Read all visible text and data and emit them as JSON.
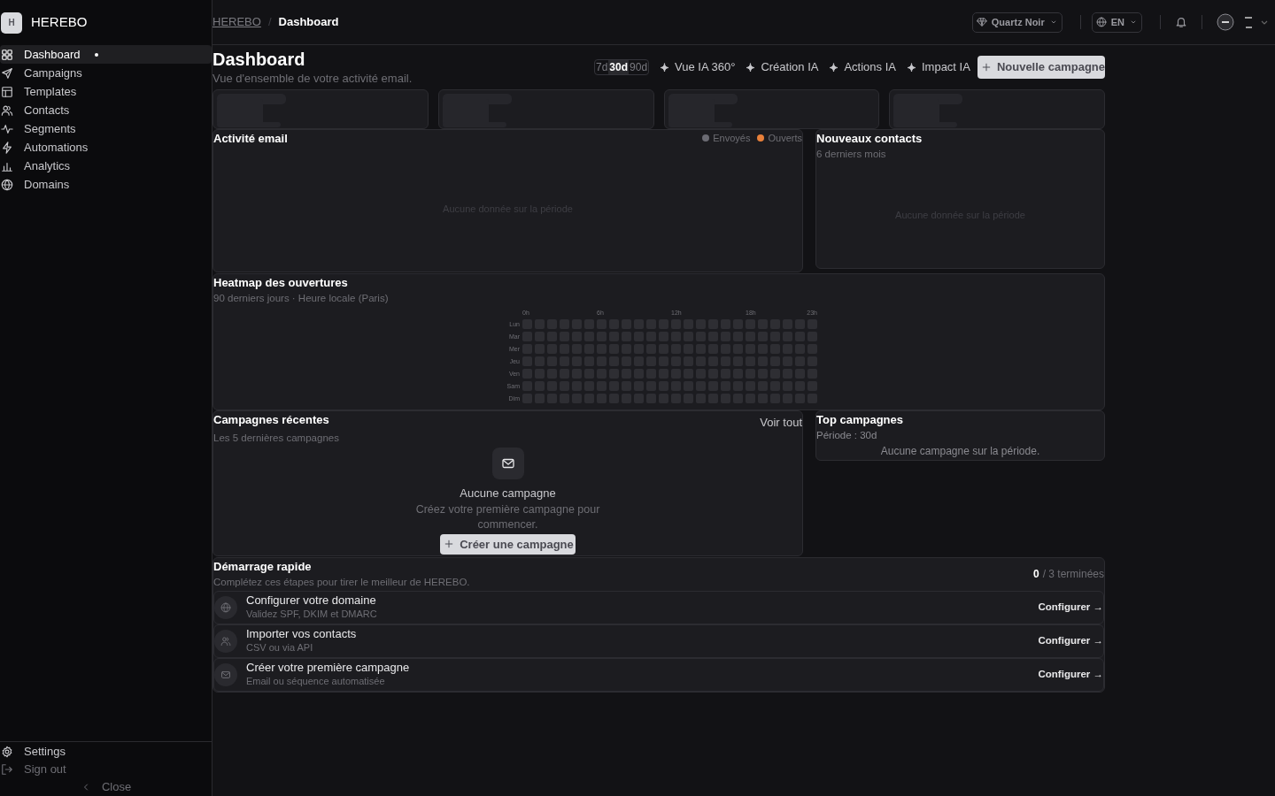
{
  "sidebar": {
    "brand": "HEREBO",
    "logo_letter": "H",
    "items": [
      {
        "label": "Dashboard",
        "selected": true
      },
      {
        "label": "Campaigns",
        "selected": false
      },
      {
        "label": "Templates",
        "selected": false
      },
      {
        "label": "Contacts",
        "selected": false
      },
      {
        "label": "Segments",
        "selected": false
      },
      {
        "label": "Automations",
        "selected": false
      },
      {
        "label": "Analytics",
        "selected": false
      },
      {
        "label": "Domains",
        "selected": false
      }
    ],
    "footer": [
      {
        "label": "Settings",
        "kind": "settings"
      },
      {
        "label": "Sign out",
        "kind": "signout"
      }
    ],
    "close": "Close"
  },
  "header": {
    "breadcrumb": [
      "HEREBO",
      "Dashboard"
    ],
    "breadcrumb_separator": "/",
    "theme": "Quartz Noir",
    "language": "EN"
  },
  "page": {
    "title": "Dashboard",
    "subtitle": "Vue d'ensemble de votre activité email.",
    "periods": [
      {
        "label": "7d",
        "selected": false
      },
      {
        "label": "30d",
        "selected": true
      },
      {
        "label": "90d",
        "selected": false
      }
    ],
    "ai_links": [
      "Vue IA 360°",
      "Création IA",
      "Actions IA",
      "Impact IA"
    ],
    "new_button": "Nouvelle campagne"
  },
  "stat_cards": [
    {
      "loading": true
    },
    {
      "loading": true
    },
    {
      "loading": true
    },
    {
      "loading": true
    }
  ],
  "activity": {
    "title": "Activité email",
    "legend": [
      {
        "label": "Envoyés",
        "color": "#6b6b73"
      },
      {
        "label": "Ouverts",
        "color": "#e8803a"
      }
    ],
    "empty": "Aucune donnée sur la période"
  },
  "new_contacts": {
    "title": "Nouveaux contacts",
    "subtitle": "6 derniers mois",
    "empty": "Aucune donnée sur la période"
  },
  "heatmap": {
    "title": "Heatmap des ouvertures",
    "subtitle": "90 derniers jours · Heure locale (Paris)",
    "hour_labels": [
      "0h",
      "6h",
      "12h",
      "18h",
      "23h"
    ],
    "days": [
      "Lun",
      "Mar",
      "Mer",
      "Jeu",
      "Ven",
      "Sam",
      "Dim"
    ]
  },
  "recent": {
    "title": "Campagnes récentes",
    "subtitle": "Les 5 dernières campagnes",
    "link": "Voir tout",
    "empty_title": "Aucune campagne",
    "empty_text": "Créez votre première campagne pour commencer.",
    "button": "Créer une campagne"
  },
  "top": {
    "title": "Top campagnes",
    "subtitle": "Période : 30d",
    "empty": "Aucune campagne sur la période."
  },
  "quickstart": {
    "title": "Démarrage rapide",
    "subtitle": "Complétez ces étapes pour tirer le meilleur de HEREBO.",
    "done": "0",
    "total": "/ 3 terminées",
    "steps": [
      {
        "kind": "domain",
        "title": "Configurer votre domaine",
        "text": "Validez SPF, DKIM et DMARC",
        "action": "Configurer →"
      },
      {
        "kind": "contacts",
        "title": "Importer vos contacts",
        "text": "CSV ou via API",
        "action": "Configurer →"
      },
      {
        "kind": "campaign",
        "title": "Créer votre première campagne",
        "text": "Email ou séquence automatisée",
        "action": "Configurer →"
      }
    ]
  }
}
